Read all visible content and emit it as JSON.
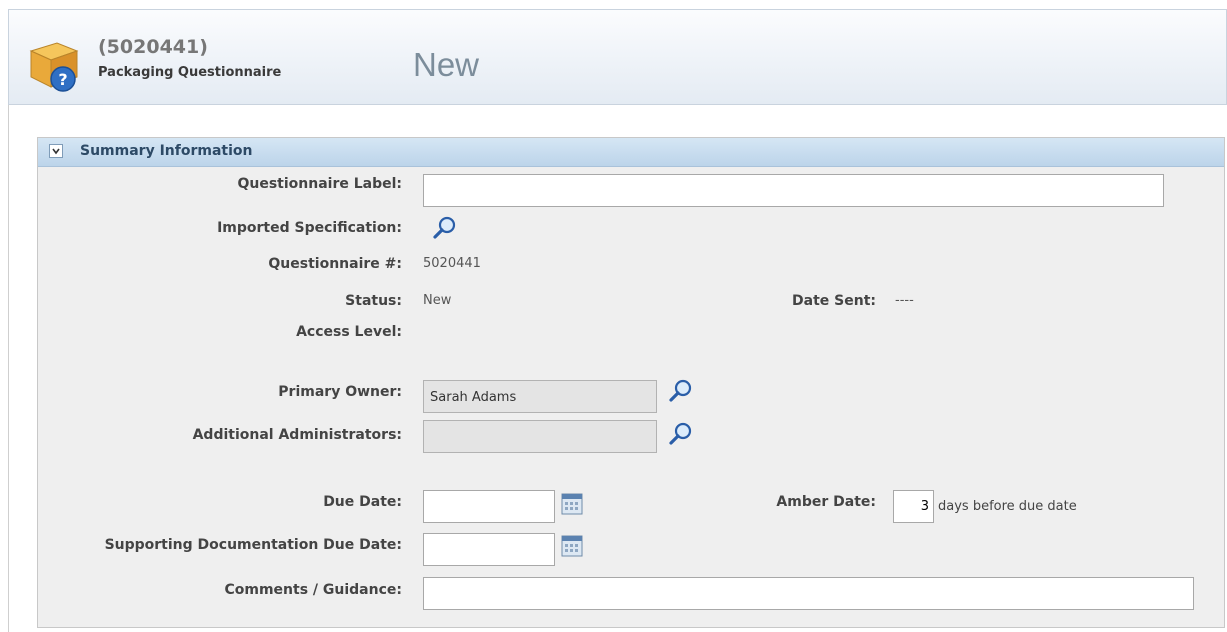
{
  "header": {
    "record_id": "(5020441)",
    "record_type": "Packaging Questionnaire",
    "status": "New"
  },
  "summary": {
    "title": "Summary Information",
    "fields": {
      "questionnaire_label": {
        "label": "Questionnaire Label:",
        "value": ""
      },
      "imported_specification": {
        "label": "Imported Specification:"
      },
      "questionnaire_number": {
        "label": "Questionnaire #:",
        "value": "5020441"
      },
      "status": {
        "label": "Status:",
        "value": "New"
      },
      "date_sent": {
        "label": "Date Sent:",
        "value": "----"
      },
      "access_level": {
        "label": "Access Level:"
      },
      "primary_owner": {
        "label": "Primary Owner:",
        "value": "Sarah Adams"
      },
      "additional_administrators": {
        "label": "Additional Administrators:",
        "value": ""
      },
      "due_date": {
        "label": "Due Date:",
        "value": ""
      },
      "amber_date": {
        "label": "Amber Date:",
        "value": "3",
        "suffix": "days before due date"
      },
      "supporting_doc_due_date": {
        "label": "Supporting Documentation Due Date:",
        "value": ""
      },
      "comments_guidance": {
        "label": "Comments / Guidance:",
        "value": ""
      }
    }
  },
  "colors": {
    "header_bg": "#e4ebf3",
    "section_header_bg": "#c9ddf0",
    "section_title": "#2d4a66",
    "status_text": "#7c8d9b"
  },
  "icons": {
    "header": "questionnaire-box-icon",
    "lookup": "magnifier-icon",
    "calendar": "calendar-icon",
    "toggle": "chevron-down-icon"
  }
}
